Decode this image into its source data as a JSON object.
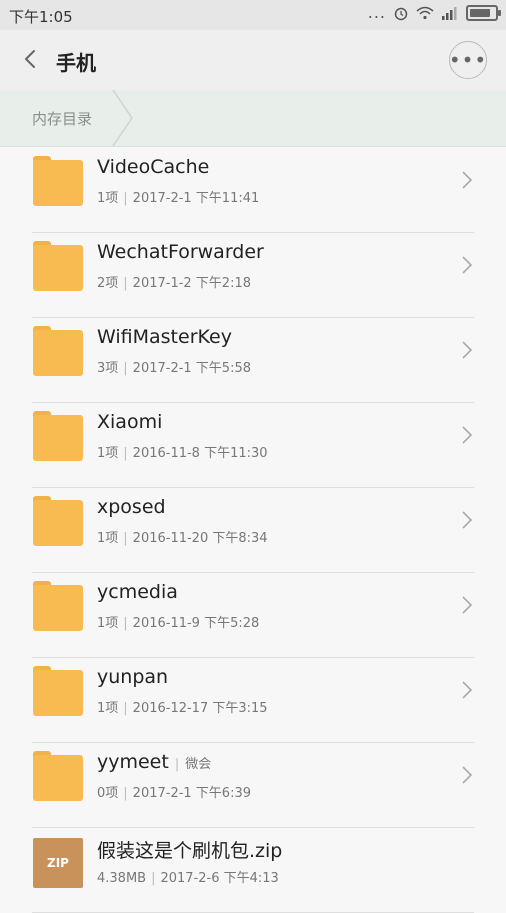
{
  "status": {
    "time": "下午1:05",
    "dots": "...",
    "signal": ""
  },
  "header": {
    "title": "手机",
    "more": "•••"
  },
  "breadcrumb": {
    "label": "内存目录"
  },
  "items": [
    {
      "name": "VideoCache",
      "count": "1项",
      "date": "2017-2-1 下午11:41",
      "type": "folder"
    },
    {
      "name": "WechatForwarder",
      "count": "2项",
      "date": "2017-1-2 下午2:18",
      "type": "folder"
    },
    {
      "name": "WifiMasterKey",
      "count": "3项",
      "date": "2017-2-1 下午5:58",
      "type": "folder"
    },
    {
      "name": "Xiaomi",
      "count": "1项",
      "date": "2016-11-8 下午11:30",
      "type": "folder"
    },
    {
      "name": "xposed",
      "count": "1项",
      "date": "2016-11-20 下午8:34",
      "type": "folder"
    },
    {
      "name": "ycmedia",
      "count": "1项",
      "date": "2016-11-9 下午5:28",
      "type": "folder"
    },
    {
      "name": "yunpan",
      "count": "1项",
      "date": "2016-12-17 下午3:15",
      "type": "folder"
    },
    {
      "name": "yymeet",
      "tag": "微会",
      "count": "0项",
      "date": "2017-2-1 下午6:39",
      "type": "folder"
    },
    {
      "name": "假装这是个刷机包.zip",
      "count": "4.38MB",
      "date": "2017-2-6 下午4:13",
      "type": "zip",
      "icon_text": "ZIP"
    }
  ]
}
